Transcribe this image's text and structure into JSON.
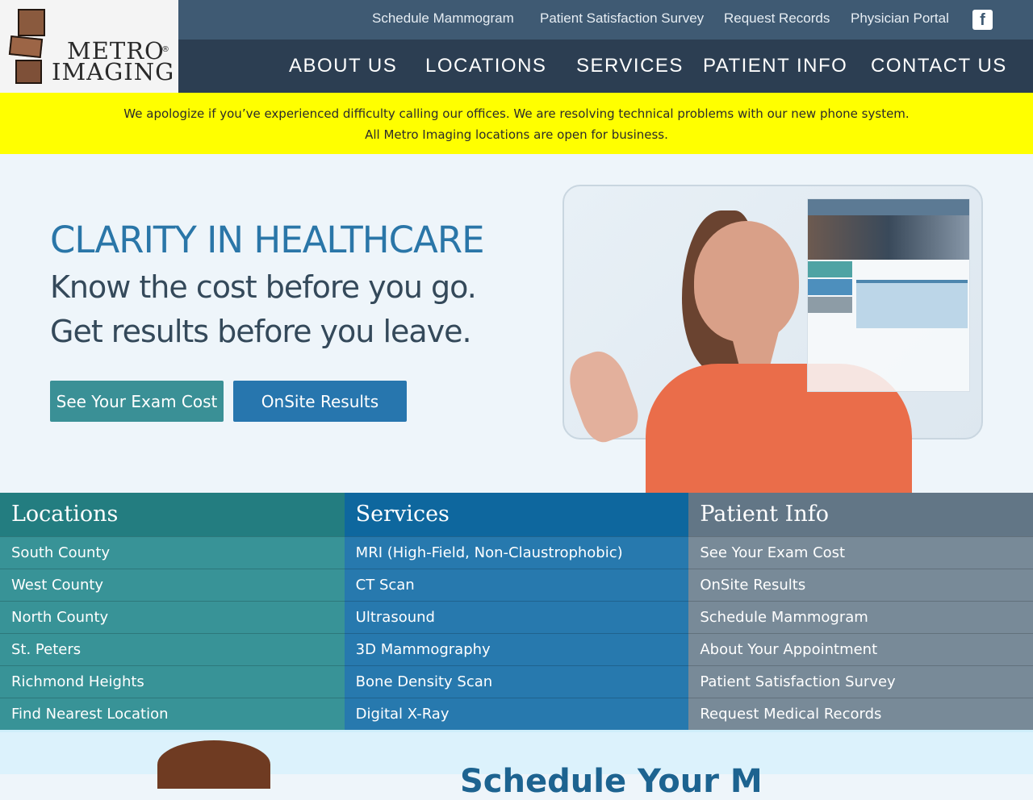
{
  "brand": {
    "name_line1": "METRO",
    "name_line2": "IMAGING",
    "registered": "®"
  },
  "utility_nav": [
    {
      "label": "Schedule Mammogram"
    },
    {
      "label": "Patient Satisfaction Survey"
    },
    {
      "label": "Request Records"
    },
    {
      "label": "Physician Portal"
    }
  ],
  "social": {
    "facebook_glyph": "f",
    "icon": "facebook-icon"
  },
  "main_nav": [
    {
      "label": "ABOUT US"
    },
    {
      "label": "LOCATIONS"
    },
    {
      "label": "SERVICES"
    },
    {
      "label": "PATIENT INFO"
    },
    {
      "label": "CONTACT US"
    }
  ],
  "alert": {
    "line1": "We apologize if you’ve experienced difficulty calling our offices. We are resolving technical problems with our new phone system.",
    "line2": "All Metro Imaging locations are open for business.",
    "background": "#ffff00"
  },
  "hero": {
    "title": "CLARITY IN HEALTHCARE",
    "line1": "Know the cost before you go.",
    "line2": "Get results before you leave.",
    "buttons": {
      "exam_cost": "See Your Exam Cost",
      "onsite": "OnSite Results"
    }
  },
  "columns": {
    "locations": {
      "title": "Locations",
      "items": [
        "South County",
        "West County",
        "North County",
        "St. Peters",
        "Richmond Heights",
        "Find Nearest Location"
      ]
    },
    "services": {
      "title": "Services",
      "items": [
        "MRI (High-Field, Non-Claustrophobic)",
        "CT Scan",
        "Ultrasound",
        "3D Mammography",
        "Bone Density Scan",
        "Digital X-Ray"
      ]
    },
    "patient_info": {
      "title": "Patient Info",
      "items": [
        "See Your Exam Cost",
        "OnSite Results",
        "Schedule Mammogram",
        "About Your Appointment",
        "Patient Satisfaction Survey",
        "Request Medical Records"
      ]
    }
  },
  "bottom": {
    "heading": "Schedule Your M"
  },
  "colors": {
    "topbar": "#3f5a73",
    "mainnav": "#2c3e52",
    "teal": "#389397",
    "blue": "#2779ae",
    "slate": "#788a98",
    "hero_title": "#2a76a8"
  }
}
